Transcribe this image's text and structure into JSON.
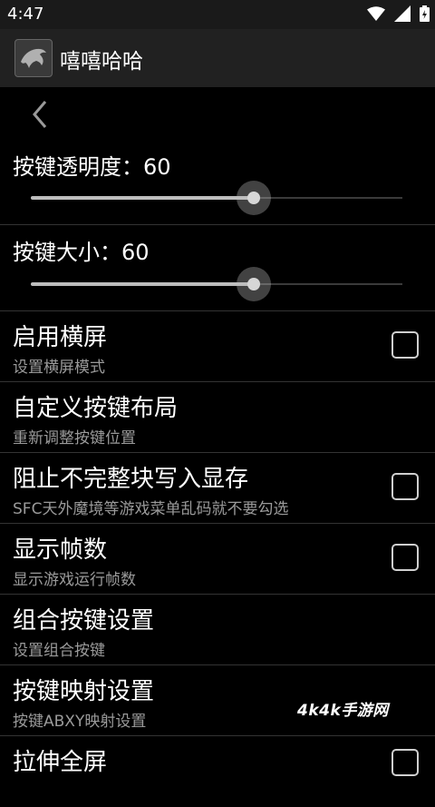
{
  "status_bar": {
    "time": "4:47"
  },
  "app_bar": {
    "title": "嘻嘻哈哈",
    "icon": "dolphin-app-icon"
  },
  "sliders": [
    {
      "label": "按键透明度：60",
      "value": 60,
      "max": 100
    },
    {
      "label": "按键大小：60",
      "value": 60,
      "max": 100
    }
  ],
  "preferences": [
    {
      "title": "启用横屏",
      "summary": "设置横屏模式",
      "has_checkbox": true,
      "checked": false
    },
    {
      "title": "自定义按键布局",
      "summary": "重新调整按键位置",
      "has_checkbox": false
    },
    {
      "title": "阻止不完整块写入显存",
      "summary": "SFC天外魔境等游戏菜单乱码就不要勾选",
      "has_checkbox": true,
      "checked": false
    },
    {
      "title": "显示帧数",
      "summary": "显示游戏运行帧数",
      "has_checkbox": true,
      "checked": false
    },
    {
      "title": "组合按键设置",
      "summary": "设置组合按键",
      "has_checkbox": false
    },
    {
      "title": "按键映射设置",
      "summary": "按键ABXY映射设置",
      "has_checkbox": false
    },
    {
      "title": "拉伸全屏",
      "summary": "",
      "has_checkbox": true,
      "checked": false
    }
  ],
  "watermark": "4k4k手游网",
  "colors": {
    "background": "#000000",
    "app_bar": "#212121",
    "summary_text": "#9a9a9a",
    "slider_fill": "#bdbdbd"
  }
}
